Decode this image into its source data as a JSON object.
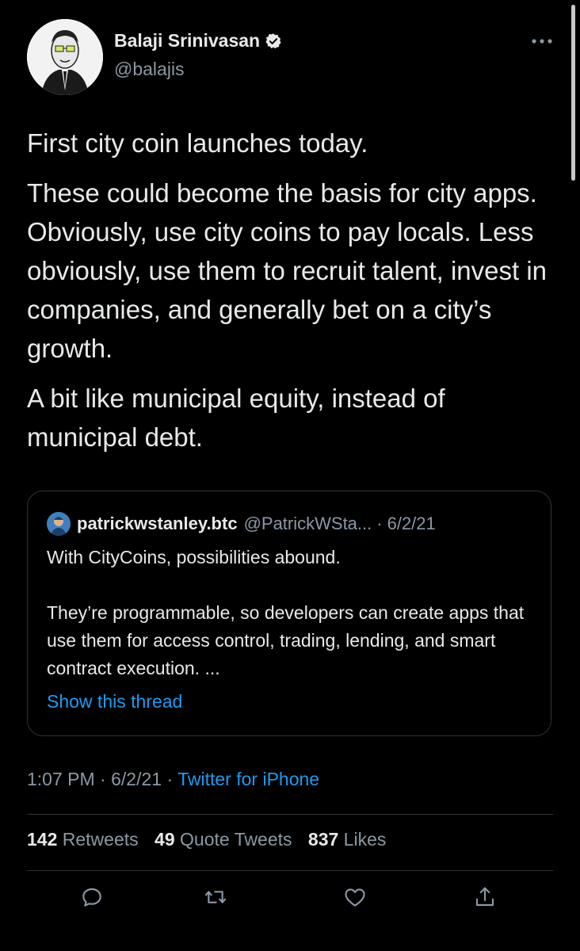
{
  "author": {
    "name": "Balaji Srinivasan",
    "handle": "@balajis",
    "verified": true
  },
  "tweet": {
    "paragraphs": [
      "First city coin launches today.",
      "These could become the basis for city apps. Obviously, use city coins to pay locals. Less obviously, use them to recruit talent, invest in companies, and generally bet on a city’s growth.",
      "A bit like municipal equity, instead of municipal debt."
    ]
  },
  "quote": {
    "name": "patrickwstanley.btc",
    "handle": "@PatrickWSta...",
    "separator": "·",
    "date": "6/2/21",
    "paragraphs": [
      "With CityCoins, possibilities abound.",
      "They’re programmable, so developers can create apps that use them for access control, trading, lending, and smart contract execution. ..."
    ],
    "link": "Show this thread"
  },
  "meta": {
    "time": "1:07 PM",
    "separator": "·",
    "date": "6/2/21",
    "source": "Twitter for iPhone"
  },
  "stats": {
    "retweets_count": "142",
    "retweets_label": "Retweets",
    "quotes_count": "49",
    "quotes_label": "Quote Tweets",
    "likes_count": "837",
    "likes_label": "Likes"
  },
  "colors": {
    "background": "#000000",
    "text": "#e7e9ea",
    "secondary": "#8b98a5",
    "accent": "#1d9bf0",
    "verified": "#e7e9ea"
  },
  "icons": {
    "more": "more-icon",
    "reply": "reply-icon",
    "retweet": "retweet-icon",
    "like": "like-icon",
    "share": "share-icon"
  }
}
